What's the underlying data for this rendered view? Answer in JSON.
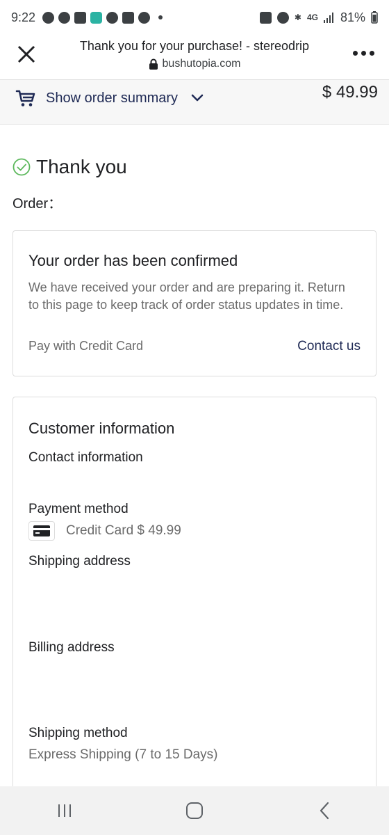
{
  "status_bar": {
    "time": "9:22",
    "battery": "81%",
    "network": "4G"
  },
  "browser": {
    "title": "Thank you for your purchase! - stereodrip",
    "domain": "bushutopia.com"
  },
  "summary_bar": {
    "toggle_label": "Show order summary",
    "total": "$ 49.99"
  },
  "main": {
    "thank_you": "Thank you",
    "order_label": "Order："
  },
  "confirmation": {
    "heading": "Your order has been confirmed",
    "body": "We have received your order and are preparing it. Return to this page to keep track of order status updates in time.",
    "pay_with": "Pay with Credit Card",
    "contact_link": "Contact us"
  },
  "customer": {
    "heading": "Customer information",
    "contact_label": "Contact information",
    "payment_label": "Payment method",
    "payment_value": "Credit Card $ 49.99",
    "shipping_address_label": "Shipping address",
    "billing_address_label": "Billing address",
    "shipping_method_label": "Shipping method",
    "shipping_method_value": "Express Shipping (7 to 15 Days)"
  },
  "icons": {
    "accent_green": "#5cb85c",
    "accent_navy": "#1f2a55"
  }
}
